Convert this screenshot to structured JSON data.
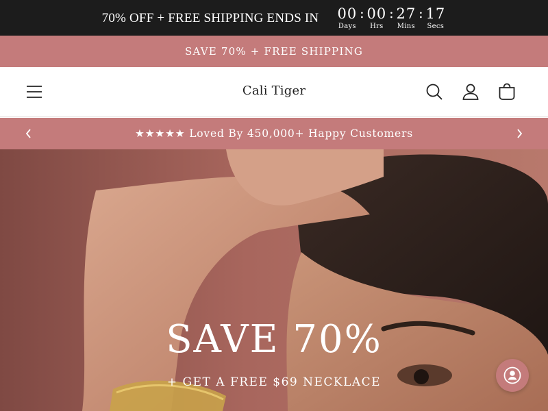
{
  "countdown": {
    "text": "70% OFF + FREE SHIPPING ENDS IN",
    "units": [
      {
        "value": "00",
        "label": "Days"
      },
      {
        "value": "00",
        "label": "Hrs"
      },
      {
        "value": "27",
        "label": "Mins"
      },
      {
        "value": "17",
        "label": "Secs"
      }
    ],
    "separator": ":"
  },
  "promo": {
    "text": "SAVE 70% + FREE SHIPPING"
  },
  "header": {
    "logo": "Cali Tiger",
    "icons": [
      "menu-icon",
      "search-icon",
      "account-icon",
      "cart-icon"
    ]
  },
  "announcement": {
    "text": "★★★★★ Loved By 450,000+ Happy Customers"
  },
  "hero": {
    "title": "SAVE 70%",
    "subtitle": "+ GET A FREE $69 NECKLACE"
  },
  "colors": {
    "topbar": "#1c1c1c",
    "accent": "#c47b7b"
  }
}
